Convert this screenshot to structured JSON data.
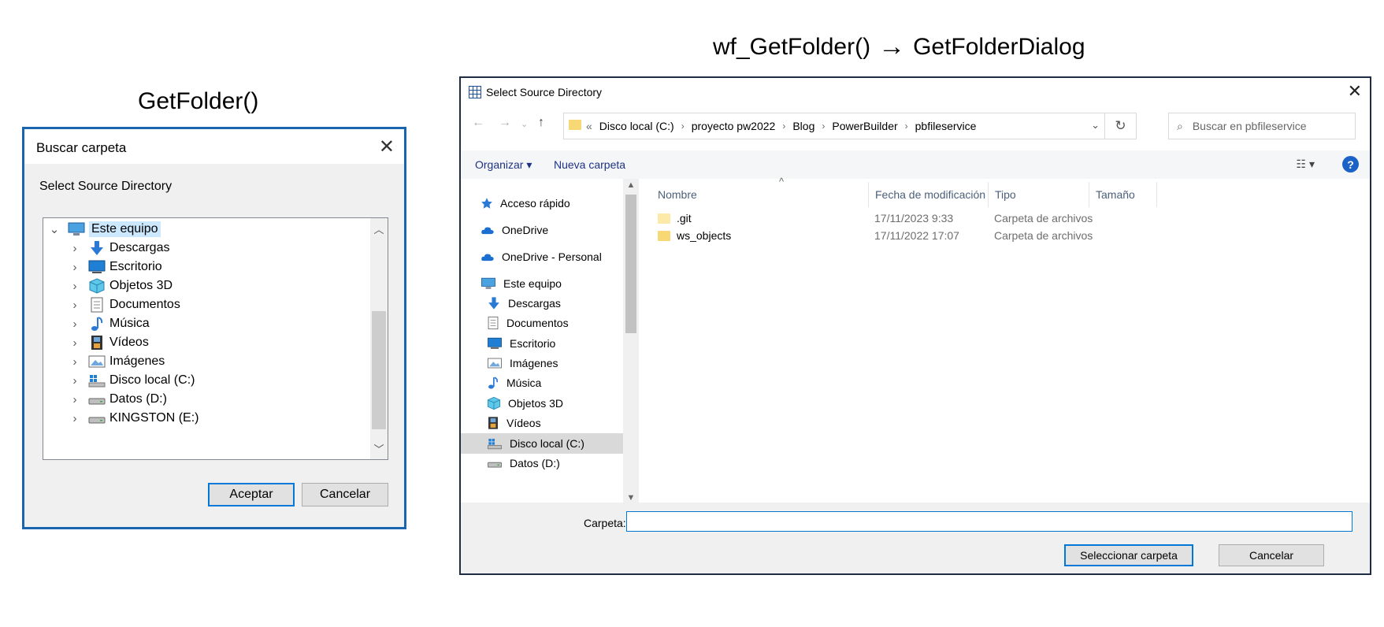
{
  "captions": {
    "left": "GetFolder()",
    "right_from": "wf_GetFolder()",
    "right_arrow": "→",
    "right_to": "GetFolderDialog"
  },
  "left_dialog": {
    "title": "Buscar carpeta",
    "description": "Select Source Directory",
    "tree": [
      {
        "label": "Este equipo",
        "icon": "computer-icon",
        "expanded": true,
        "selected": true
      },
      {
        "label": "Descargas",
        "icon": "download-arrow-icon"
      },
      {
        "label": "Escritorio",
        "icon": "desktop-icon"
      },
      {
        "label": "Objetos 3D",
        "icon": "cube-3d-icon"
      },
      {
        "label": "Documentos",
        "icon": "document-icon"
      },
      {
        "label": "Música",
        "icon": "music-note-icon"
      },
      {
        "label": "Vídeos",
        "icon": "film-icon"
      },
      {
        "label": "Imágenes",
        "icon": "picture-icon"
      },
      {
        "label": "Disco local (C:)",
        "icon": "windows-drive-icon"
      },
      {
        "label": "Datos (D:)",
        "icon": "drive-icon"
      },
      {
        "label": "KINGSTON (E:)",
        "icon": "drive-icon"
      }
    ],
    "ok_label": "Aceptar",
    "cancel_label": "Cancelar"
  },
  "right_dialog": {
    "title": "Select Source Directory",
    "breadcrumbs": [
      "Disco local (C:)",
      "proyecto pw2022",
      "Blog",
      "PowerBuilder",
      "pbfileservice"
    ],
    "search_placeholder": "Buscar en pbfileservice",
    "toolbar": {
      "organize": "Organizar",
      "new_folder": "Nueva carpeta"
    },
    "nav": [
      {
        "label": "Acceso rápido",
        "icon": "star-icon",
        "group": true
      },
      {
        "label": "OneDrive",
        "icon": "cloud-icon",
        "group": true
      },
      {
        "label": "OneDrive - Personal",
        "icon": "cloud-icon",
        "group": true
      },
      {
        "label": "Este equipo",
        "icon": "computer-icon",
        "group": true
      },
      {
        "label": "Descargas",
        "icon": "download-arrow-icon"
      },
      {
        "label": "Documentos",
        "icon": "document-icon"
      },
      {
        "label": "Escritorio",
        "icon": "desktop-icon"
      },
      {
        "label": "Imágenes",
        "icon": "picture-icon"
      },
      {
        "label": "Música",
        "icon": "music-note-icon"
      },
      {
        "label": "Objetos 3D",
        "icon": "cube-3d-icon"
      },
      {
        "label": "Vídeos",
        "icon": "film-icon"
      },
      {
        "label": "Disco local (C:)",
        "icon": "windows-drive-icon",
        "active": true
      },
      {
        "label": "Datos (D:)",
        "icon": "drive-icon"
      }
    ],
    "columns": [
      "Nombre",
      "Fecha de modificación",
      "Tipo",
      "Tamaño"
    ],
    "files": [
      {
        "name": ".git",
        "date": "17/11/2023 9:33",
        "type": "Carpeta de archivos"
      },
      {
        "name": "ws_objects",
        "date": "17/11/2022 17:07",
        "type": "Carpeta de archivos"
      }
    ],
    "folder_label": "Carpeta:",
    "folder_value": "",
    "select_label": "Seleccionar carpeta",
    "cancel_label": "Cancelar"
  }
}
